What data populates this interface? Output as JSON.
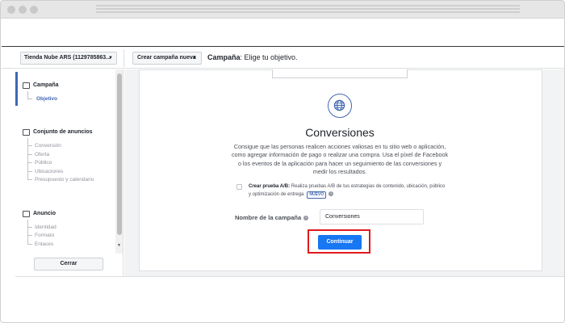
{
  "account_select": {
    "label": "Tienda Nube ARS (1129785863..."
  },
  "create_button": {
    "label": "Crear campaña nueva"
  },
  "header": {
    "title_bold": "Campaña",
    "title_rest": ": Elige tu objetivo."
  },
  "sidebar": {
    "campaign": {
      "label": "Campaña",
      "items": [
        "Objetivo"
      ]
    },
    "adset": {
      "label": "Conjunto de anuncios",
      "items": [
        "Conversión",
        "Oferta",
        "Público",
        "Ubicaciones",
        "Presupuesto y calendario"
      ]
    },
    "ad": {
      "label": "Anuncio",
      "items": [
        "Identidad",
        "Formato",
        "Enlaces"
      ]
    },
    "close_label": "Cerrar"
  },
  "objective": {
    "icon": "globe-icon",
    "title": "Conversiones",
    "description": "Consigue que las personas realicen acciones valiosas en tu sitio web o aplicación, como agregar información de pago o realizar una compra. Usa el píxel de Facebook o los eventos de la aplicación para hacer un seguimiento de las conversiones y medir los resultados."
  },
  "ab_test": {
    "label": "Crear prueba A/B:",
    "description": "Realiza pruebas A/B de tus estrategias de contenido, ubicación, público y optimización de entrega",
    "badge": "NUEVO",
    "checked": false
  },
  "campaign_name": {
    "label": "Nombre de la campaña",
    "value": "Conversiones"
  },
  "continue_label": "Continuar",
  "colors": {
    "primary": "#1877f2",
    "accent": "#4267b2",
    "highlight": "#e0191c"
  }
}
